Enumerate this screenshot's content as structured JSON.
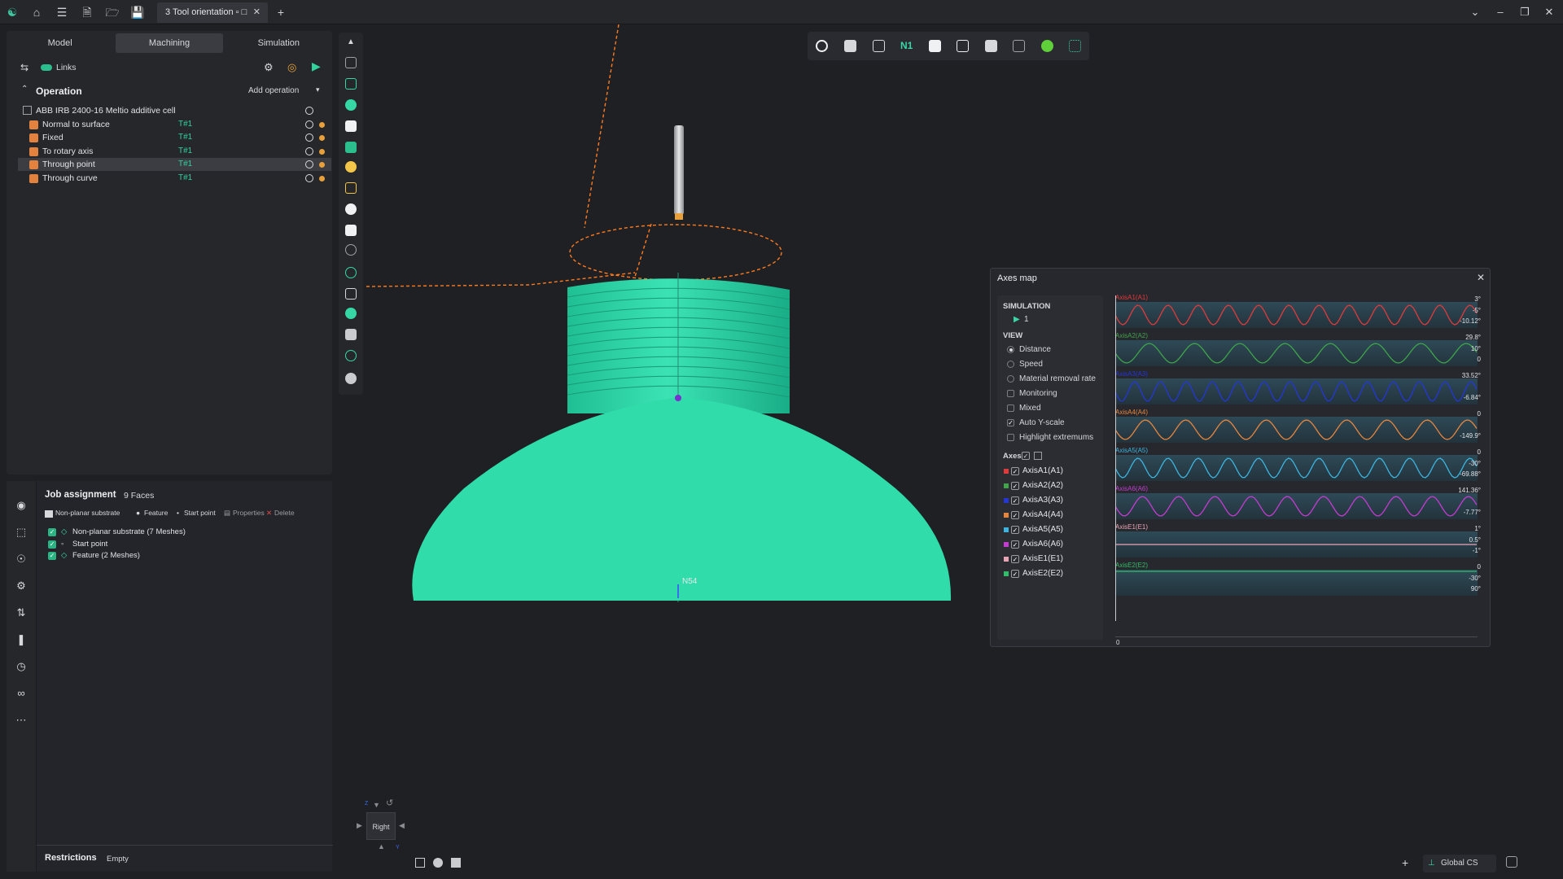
{
  "titlebar": {
    "tab_label": "3 Tool orientation ▫ □",
    "new_tab_label": "+"
  },
  "left_panel": {
    "tabs": [
      "Model",
      "Machining",
      "Simulation"
    ],
    "links_label": "Links",
    "operation_title": "Operation",
    "add_operation_label": "Add operation",
    "cell_name": "ABB IRB 2400-16 Meltio additive cell",
    "operations": [
      {
        "name": "Normal to surface",
        "tool": "T#1"
      },
      {
        "name": "Fixed",
        "tool": "T#1"
      },
      {
        "name": "To rotary axis",
        "tool": "T#1"
      },
      {
        "name": "Through point",
        "tool": "T#1"
      },
      {
        "name": "Through curve",
        "tool": "T#1"
      }
    ]
  },
  "job": {
    "title": "Job assignment",
    "count": "9 Faces",
    "toolbar": [
      "Non-planar substrate",
      "Feature",
      "Start point",
      "Properties",
      "Delete"
    ],
    "items": [
      "Non-planar substrate (7 Meshes)",
      "Start point",
      "Feature (2 Meshes)"
    ],
    "restrictions_label": "Restrictions",
    "restrictions_value": "Empty"
  },
  "viewport": {
    "point_label": "N54",
    "view_cube_label": "Right",
    "cube_axis_z": "Z",
    "cube_axis_y": "Y"
  },
  "axes_map": {
    "title": "Axes map",
    "simulation_label": "SIMULATION",
    "sim_value": "1",
    "view_label": "VIEW",
    "view_options": [
      "Distance",
      "Speed",
      "Material removal rate",
      "Monitoring",
      "Mixed",
      "Auto Y-scale",
      "Highlight extremums"
    ],
    "axes_label": "Axes",
    "axes": [
      {
        "name": "AxisA1(A1)",
        "color": "#e03a3a",
        "top": "3°",
        "mid": "-5°",
        "bot": "-10.12°"
      },
      {
        "name": "AxisA2(A2)",
        "color": "#3fa44a",
        "top": "29.8°",
        "mid": "10°",
        "bot": "0"
      },
      {
        "name": "AxisA3(A3)",
        "color": "#2437d6",
        "top": "33.52°",
        "mid": "",
        "bot": "-6.84°"
      },
      {
        "name": "AxisA4(A4)",
        "color": "#e7853c",
        "top": "0",
        "mid": "",
        "bot": "-149.9°"
      },
      {
        "name": "AxisA5(A5)",
        "color": "#3bb5e0",
        "top": "0",
        "mid": "-30°",
        "bot": "-69.88°"
      },
      {
        "name": "AxisA6(A6)",
        "color": "#c43bd1",
        "top": "141.36°",
        "mid": "",
        "bot": "-7.77°"
      },
      {
        "name": "AxisE1(E1)",
        "color": "#e8a4b4",
        "top": "1°",
        "mid": "0.5°",
        "bot": "-1°"
      },
      {
        "name": "AxisE2(E2)",
        "color": "#2fbf69",
        "top": "0",
        "mid": "-30°",
        "bot": "90°"
      }
    ],
    "x_start": "0"
  },
  "bottom": {
    "cs_label": "Global CS",
    "add_label": "+"
  }
}
